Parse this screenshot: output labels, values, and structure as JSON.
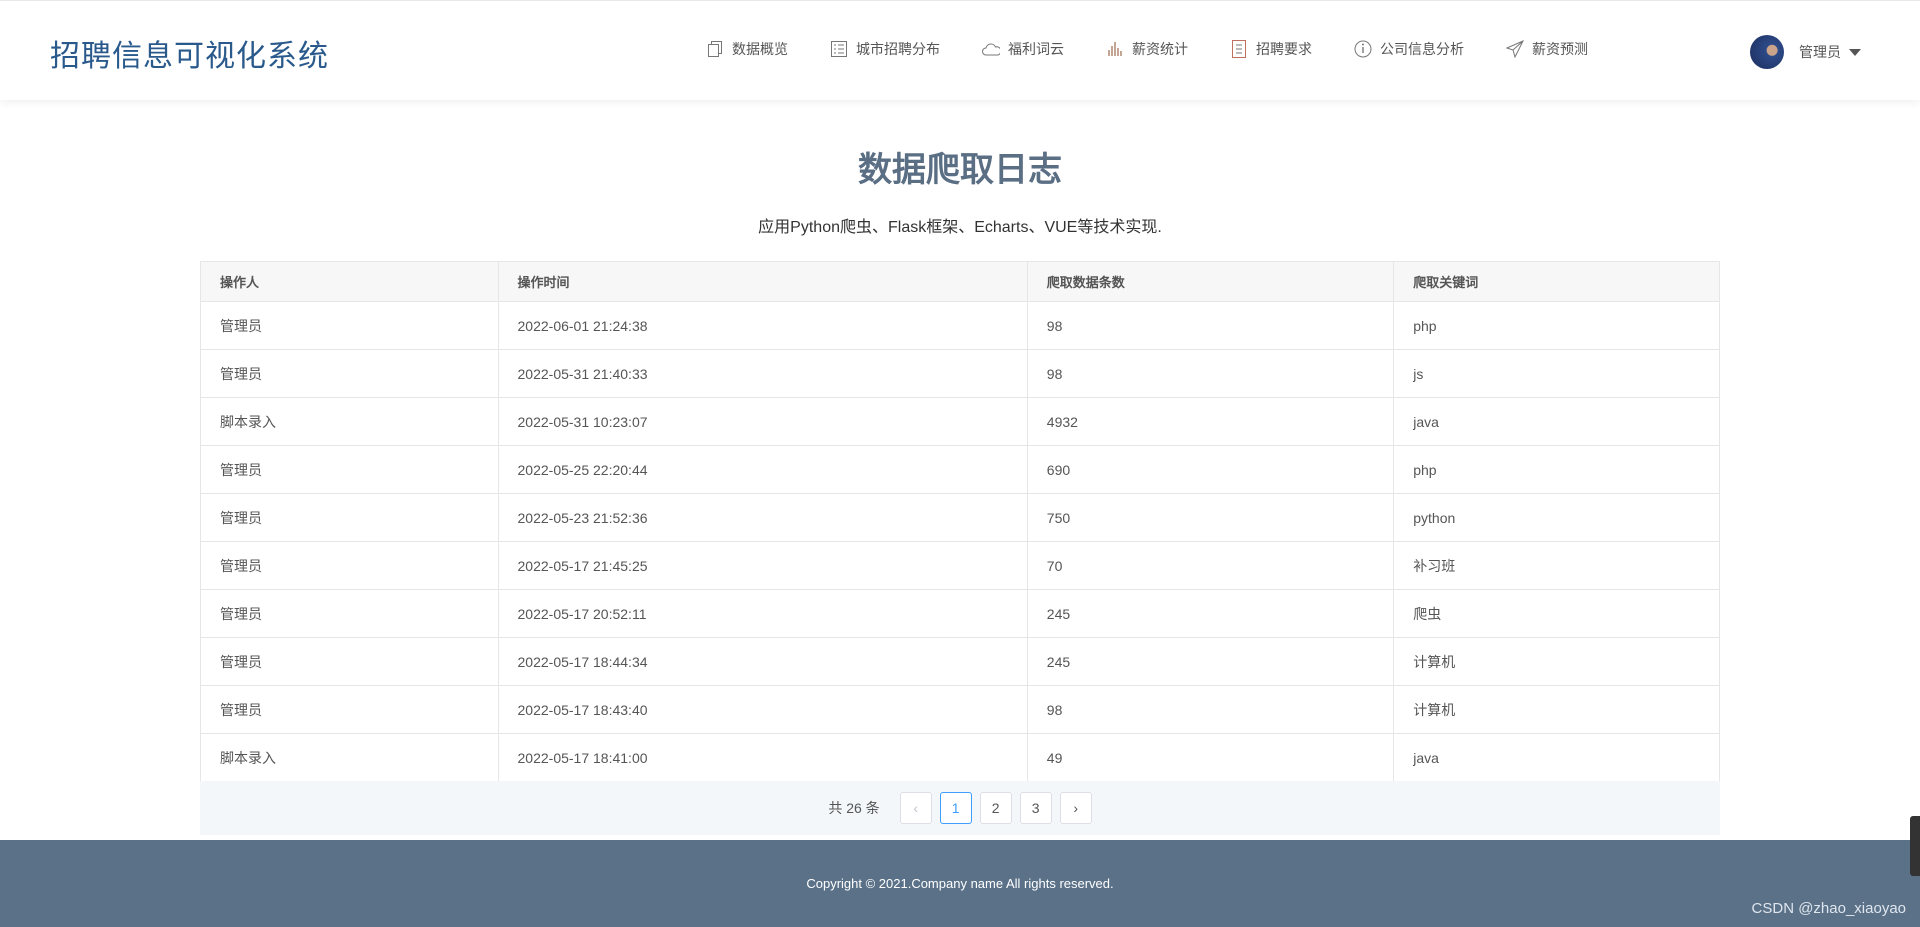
{
  "header": {
    "brand": "招聘信息可视化系统",
    "nav": [
      {
        "label": "数据概览",
        "icon": "copy-icon"
      },
      {
        "label": "城市招聘分布",
        "icon": "list-icon"
      },
      {
        "label": "福利词云",
        "icon": "cloud-icon"
      },
      {
        "label": "薪资统计",
        "icon": "bar-chart-icon"
      },
      {
        "label": "招聘要求",
        "icon": "document-icon"
      },
      {
        "label": "公司信息分析",
        "icon": "info-icon"
      },
      {
        "label": "薪资预测",
        "icon": "send-icon"
      }
    ],
    "user": "管理员"
  },
  "page": {
    "title": "数据爬取日志",
    "subtitle": "应用Python爬虫、Flask框架、Echarts、VUE等技术实现."
  },
  "table": {
    "headers": [
      "操作人",
      "操作时间",
      "爬取数据条数",
      "爬取关键词"
    ],
    "rows": [
      [
        "管理员",
        "2022-06-01 21:24:38",
        "98",
        "php"
      ],
      [
        "管理员",
        "2022-05-31 21:40:33",
        "98",
        "js"
      ],
      [
        "脚本录入",
        "2022-05-31 10:23:07",
        "4932",
        "java"
      ],
      [
        "管理员",
        "2022-05-25 22:20:44",
        "690",
        "php"
      ],
      [
        "管理员",
        "2022-05-23 21:52:36",
        "750",
        "python"
      ],
      [
        "管理员",
        "2022-05-17 21:45:25",
        "70",
        "补习班"
      ],
      [
        "管理员",
        "2022-05-17 20:52:11",
        "245",
        "爬虫"
      ],
      [
        "管理员",
        "2022-05-17 18:44:34",
        "245",
        "计算机"
      ],
      [
        "管理员",
        "2022-05-17 18:43:40",
        "98",
        "计算机"
      ],
      [
        "脚本录入",
        "2022-05-17 18:41:00",
        "49",
        "java"
      ]
    ]
  },
  "pagination": {
    "total": "共 26 条",
    "pages": [
      "1",
      "2",
      "3"
    ],
    "current": "1",
    "prev": "‹",
    "next": "›"
  },
  "footer": {
    "copyright": "Copyright © 2021.Company name All rights reserved."
  },
  "watermark": "CSDN @zhao_xiaoyao"
}
